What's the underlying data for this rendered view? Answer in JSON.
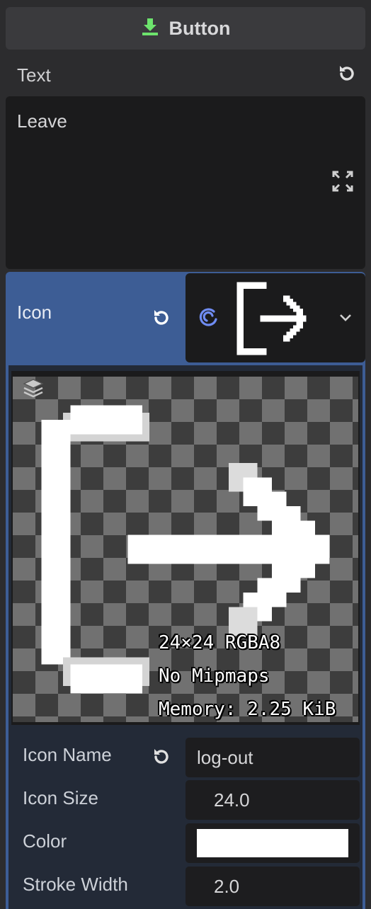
{
  "header": {
    "title": "Button",
    "icon": "download-node-icon"
  },
  "text_prop": {
    "label": "Text",
    "value": "Leave"
  },
  "icon_prop": {
    "label": "Icon",
    "resource_icon": "godot-resource-icon"
  },
  "preview": {
    "line1": "24×24 RGBA8",
    "line2": "No Mipmaps",
    "line3": "Memory: 2.25 KiB"
  },
  "props": {
    "icon_name": {
      "label": "Icon Name",
      "value": "log-out"
    },
    "icon_size": {
      "label": "Icon Size",
      "value": "24.0"
    },
    "color": {
      "label": "Color",
      "value": "#ffffff"
    },
    "stroke_width": {
      "label": "Stroke Width",
      "value": "2.0"
    }
  },
  "colors": {
    "accent": "#3d5d95",
    "header_icon": "#6de36d"
  }
}
